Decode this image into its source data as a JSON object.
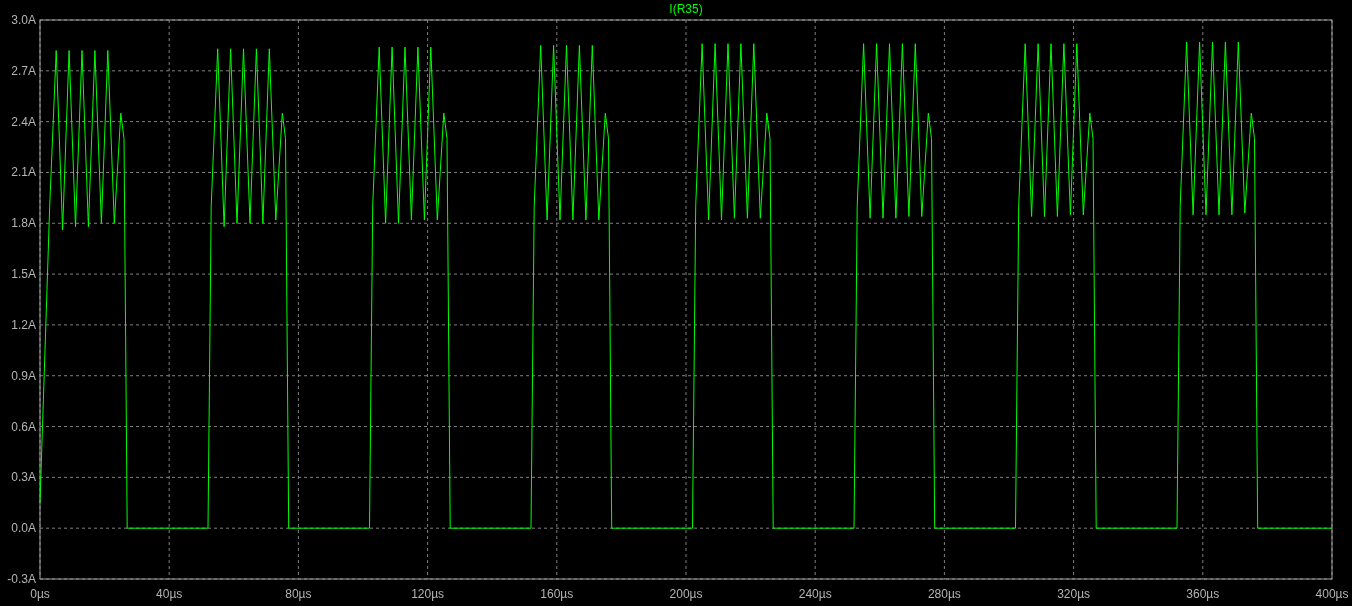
{
  "plot": {
    "chart_data": {
      "type": "line",
      "grid": true,
      "xlim": [
        0,
        400
      ],
      "ylim": [
        -0.3,
        3.0
      ],
      "xticks": [
        {
          "value": 0,
          "label": "0µs"
        },
        {
          "value": 40,
          "label": "40µs"
        },
        {
          "value": 80,
          "label": "80µs"
        },
        {
          "value": 120,
          "label": "120µs"
        },
        {
          "value": 160,
          "label": "160µs"
        },
        {
          "value": 200,
          "label": "200µs"
        },
        {
          "value": 240,
          "label": "240µs"
        },
        {
          "value": 280,
          "label": "280µs"
        },
        {
          "value": 320,
          "label": "320µs"
        },
        {
          "value": 360,
          "label": "360µs"
        },
        {
          "value": 400,
          "label": "400µs"
        }
      ],
      "yticks": [
        {
          "value": 3.0,
          "label": "3.0A"
        },
        {
          "value": 2.7,
          "label": "2.7A"
        },
        {
          "value": 2.4,
          "label": "2.4A"
        },
        {
          "value": 2.1,
          "label": "2.1A"
        },
        {
          "value": 1.8,
          "label": "1.8A"
        },
        {
          "value": 1.5,
          "label": "1.5A"
        },
        {
          "value": 1.2,
          "label": "1.2A"
        },
        {
          "value": 0.9,
          "label": "0.9A"
        },
        {
          "value": 0.6,
          "label": "0.6A"
        },
        {
          "value": 0.3,
          "label": "0.3A"
        },
        {
          "value": 0.0,
          "label": "0.0A"
        },
        {
          "value": -0.3,
          "label": "-0.3A"
        }
      ],
      "x": [
        0,
        3,
        5,
        7,
        9,
        11,
        13,
        15,
        17,
        19,
        21,
        23,
        25,
        26,
        27,
        52,
        53,
        55,
        57,
        59,
        61,
        63,
        65,
        67,
        69,
        71,
        73,
        75,
        76,
        77,
        102,
        103,
        105,
        107,
        109,
        111,
        113,
        115,
        117,
        119,
        121,
        123,
        125,
        126,
        127,
        152,
        153,
        155,
        157,
        159,
        161,
        163,
        165,
        167,
        169,
        171,
        173,
        175,
        176,
        177,
        202,
        203,
        205,
        207,
        209,
        211,
        213,
        215,
        217,
        219,
        221,
        223,
        225,
        226,
        227,
        252,
        253,
        255,
        257,
        259,
        261,
        263,
        265,
        267,
        269,
        271,
        273,
        275,
        276,
        277,
        302,
        303,
        305,
        307,
        309,
        311,
        313,
        315,
        317,
        319,
        321,
        323,
        325,
        326,
        327,
        352,
        353,
        355,
        357,
        359,
        361,
        363,
        365,
        367,
        369,
        371,
        373,
        375,
        376,
        377,
        400
      ],
      "series": [
        {
          "name": "I(R35)",
          "color": "#00ff00",
          "values": [
            0.15,
            1.9,
            2.82,
            1.76,
            2.82,
            1.78,
            2.82,
            1.78,
            2.82,
            1.8,
            2.82,
            1.8,
            2.45,
            2.3,
            0,
            0,
            1.9,
            2.83,
            1.78,
            2.83,
            1.8,
            2.83,
            1.8,
            2.83,
            1.8,
            2.83,
            1.82,
            2.45,
            2.3,
            0,
            0,
            1.9,
            2.84,
            1.8,
            2.84,
            1.8,
            2.84,
            1.82,
            2.84,
            1.82,
            2.84,
            1.82,
            2.45,
            2.3,
            0,
            0,
            1.9,
            2.85,
            1.82,
            2.85,
            1.82,
            2.85,
            1.82,
            2.85,
            1.82,
            2.85,
            1.82,
            2.45,
            2.3,
            0,
            0,
            1.9,
            2.86,
            1.82,
            2.86,
            1.82,
            2.86,
            1.83,
            2.86,
            1.83,
            2.86,
            1.83,
            2.45,
            2.3,
            0,
            0,
            1.9,
            2.86,
            1.83,
            2.86,
            1.83,
            2.86,
            1.83,
            2.86,
            1.84,
            2.86,
            1.84,
            2.45,
            2.3,
            0,
            0,
            1.9,
            2.86,
            1.84,
            2.86,
            1.84,
            2.86,
            1.84,
            2.86,
            1.85,
            2.86,
            1.85,
            2.45,
            2.3,
            0,
            0,
            1.9,
            2.87,
            1.85,
            2.87,
            1.85,
            2.87,
            1.85,
            2.87,
            1.85,
            2.87,
            1.86,
            2.45,
            2.3,
            0,
            0
          ]
        }
      ]
    }
  }
}
